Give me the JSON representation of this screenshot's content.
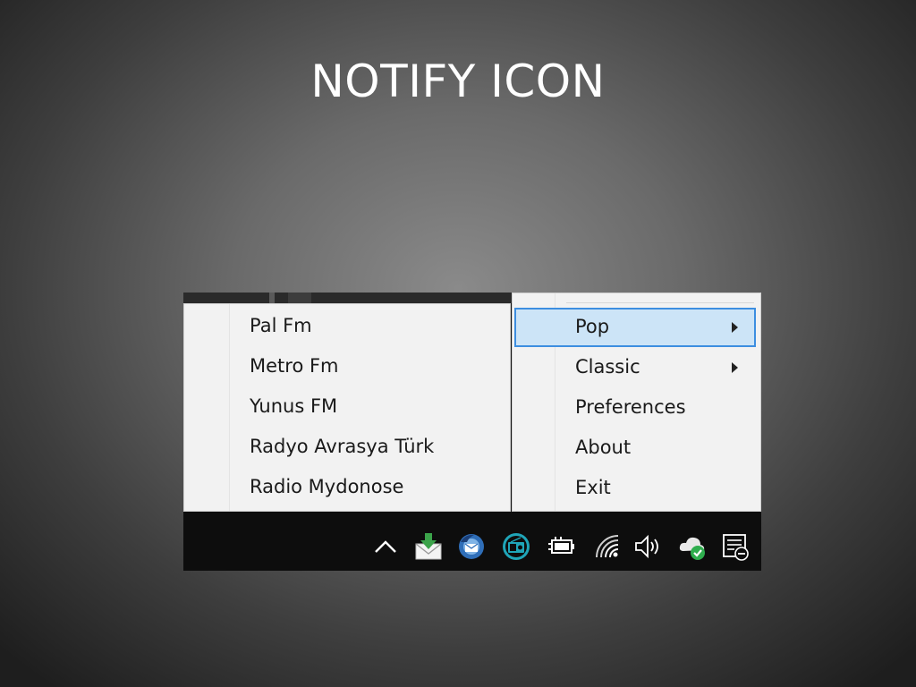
{
  "slide": {
    "title": "NOTIFY ICON"
  },
  "stations_menu": {
    "items": [
      {
        "label": "Pal Fm"
      },
      {
        "label": "Metro Fm"
      },
      {
        "label": "Yunus FM"
      },
      {
        "label": "Radyo Avrasya Türk"
      },
      {
        "label": "Radio Mydonose"
      }
    ]
  },
  "context_menu": {
    "items": [
      {
        "label": "Pop",
        "has_submenu": true,
        "highlighted": true
      },
      {
        "label": "Classic",
        "has_submenu": true
      },
      {
        "label": "Preferences"
      },
      {
        "label": "About"
      },
      {
        "label": "Exit"
      }
    ]
  },
  "taskbar": {
    "tray_icons": [
      "chevron-up-icon",
      "mail-download-icon",
      "thunderbird-icon",
      "radio-app-icon",
      "power-battery-icon",
      "wifi-icon",
      "volume-icon",
      "cloud-sync-icon",
      "action-center-icon"
    ]
  },
  "colors": {
    "highlight_bg": "#cce4f7",
    "highlight_border": "#3d8ee0",
    "menu_bg": "#f2f2f2",
    "taskbar_bg": "#0d0d0d"
  }
}
